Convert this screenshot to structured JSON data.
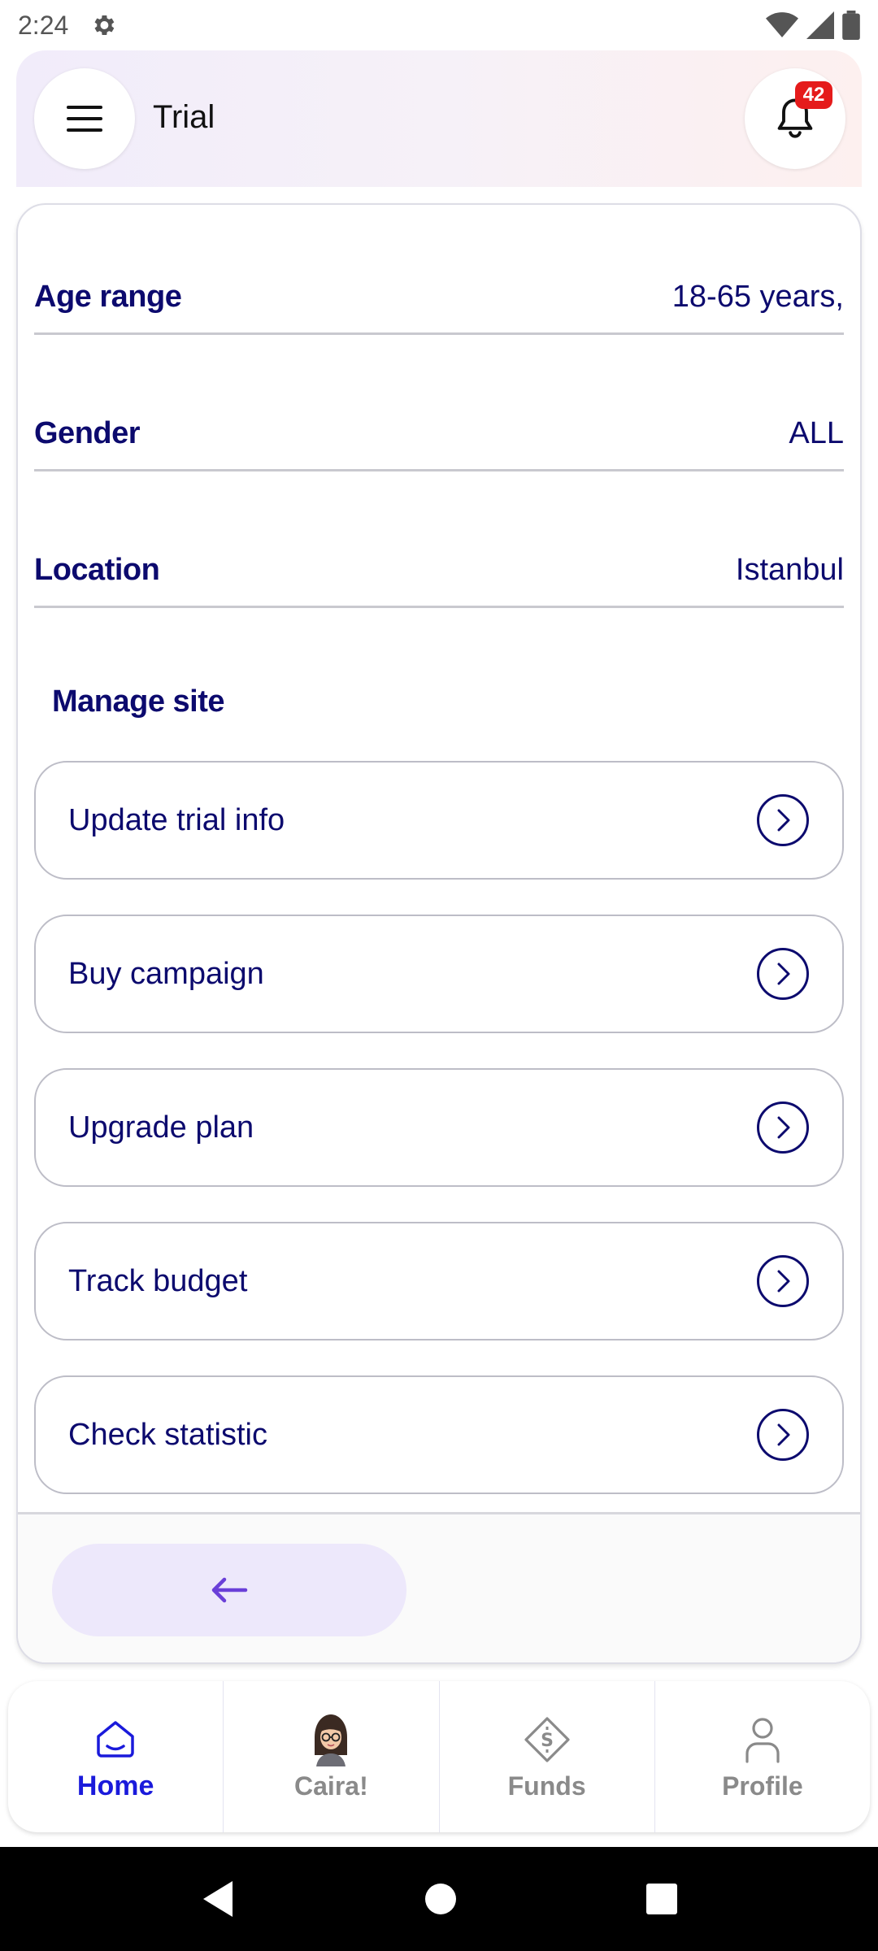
{
  "status_bar": {
    "time": "2:24"
  },
  "header": {
    "title": "Trial",
    "notification_count": "42"
  },
  "details": [
    {
      "label": "Age range",
      "value": "18-65 years,"
    },
    {
      "label": "Gender",
      "value": "ALL"
    },
    {
      "label": "Location",
      "value": "Istanbul"
    }
  ],
  "manage": {
    "title": "Manage site",
    "items": [
      {
        "label": "Update trial info"
      },
      {
        "label": "Buy campaign"
      },
      {
        "label": "Upgrade plan"
      },
      {
        "label": "Track budget"
      },
      {
        "label": "Check statistic"
      }
    ]
  },
  "bottom_nav": {
    "items": [
      {
        "label": "Home",
        "icon": "home-icon",
        "active": true
      },
      {
        "label": "Caira!",
        "icon": "avatar"
      },
      {
        "label": "Funds",
        "icon": "funds-icon"
      },
      {
        "label": "Profile",
        "icon": "profile-icon"
      }
    ]
  },
  "colors": {
    "primary_text": "#0c0a6e",
    "active_nav": "#1a1adb",
    "badge": "#e51b1b",
    "back_button_bg": "#ede8fb",
    "back_arrow": "#6a3fd8"
  }
}
